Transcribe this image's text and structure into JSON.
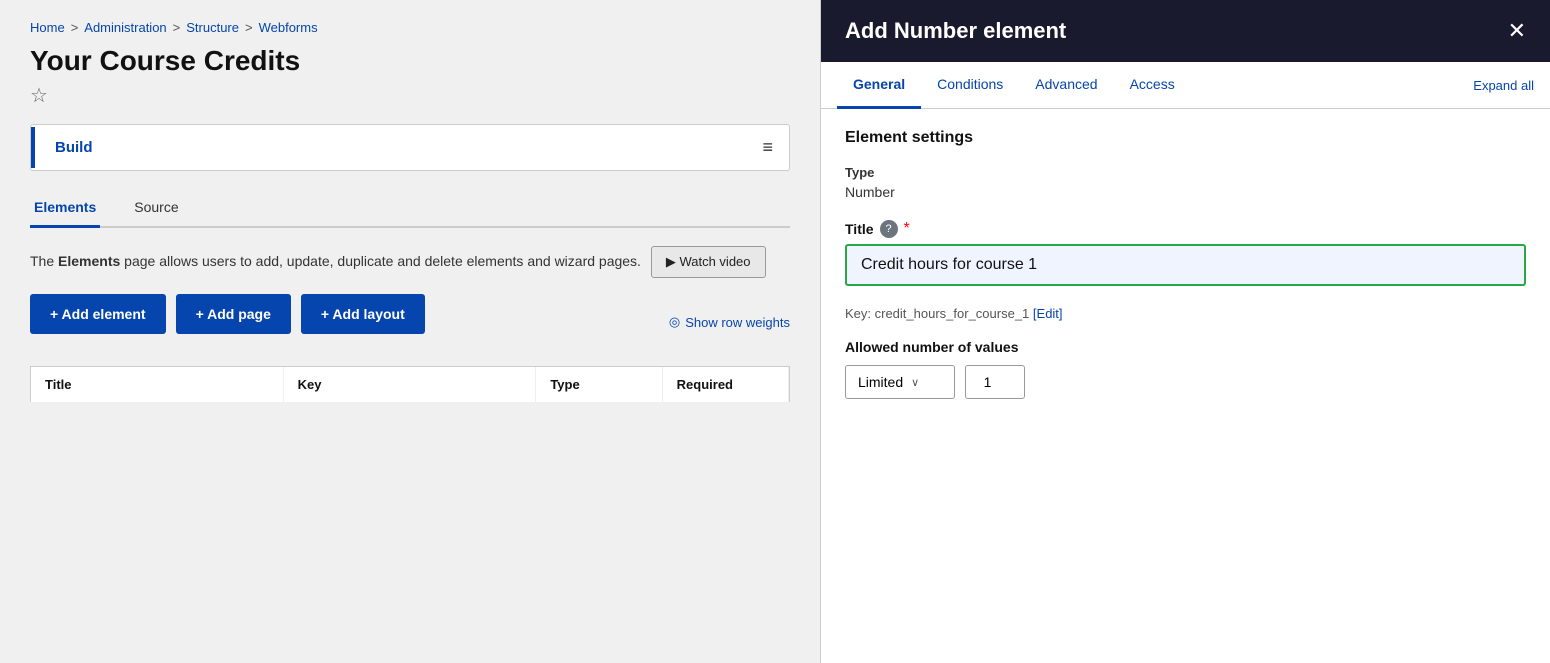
{
  "breadcrumb": {
    "items": [
      {
        "label": "Home",
        "href": "#"
      },
      {
        "label": "Administration",
        "href": "#"
      },
      {
        "label": "Structure",
        "href": "#"
      },
      {
        "label": "Webforms",
        "href": "#"
      }
    ],
    "separators": [
      ">",
      ">",
      ">"
    ]
  },
  "page": {
    "title": "Your Course Credits",
    "star_label": "☆"
  },
  "build_nav": {
    "item_label": "Build",
    "hamburger": "≡"
  },
  "tabs": {
    "items": [
      {
        "label": "Elements",
        "active": true
      },
      {
        "label": "Source",
        "active": false
      }
    ]
  },
  "description": {
    "prefix": "The ",
    "bold": "Elements",
    "suffix": " page allows users to add, update, duplicate and delete elements and wizard pages."
  },
  "watch_video": {
    "label": "▶ Watch video"
  },
  "action_buttons": [
    {
      "label": "+ Add element"
    },
    {
      "label": "+ Add page"
    },
    {
      "label": "+ Add layout"
    }
  ],
  "show_row_weights": {
    "icon": "◎",
    "label": "Show row weights"
  },
  "table_headers": [
    "Title",
    "Key",
    "Type",
    "Required"
  ],
  "right_panel": {
    "header": {
      "title": "Add Number element",
      "close_icon": "✕"
    },
    "tabs": [
      {
        "label": "General",
        "active": true
      },
      {
        "label": "Conditions",
        "active": false
      },
      {
        "label": "Advanced",
        "active": false
      },
      {
        "label": "Access",
        "active": false
      }
    ],
    "expand_all": "Expand all",
    "section_title": "Element settings",
    "type_label": "Type",
    "type_value": "Number",
    "title_label": "Title",
    "title_help": "?",
    "title_required": "*",
    "title_value": "Credit hours for course 1",
    "key_prefix": "Key: credit_hours_for_course_1",
    "key_edit": "[Edit]",
    "allowed_label": "Allowed number of values",
    "dropdown_value": "Limited",
    "dropdown_arrow": "∨",
    "number_value": "1"
  }
}
